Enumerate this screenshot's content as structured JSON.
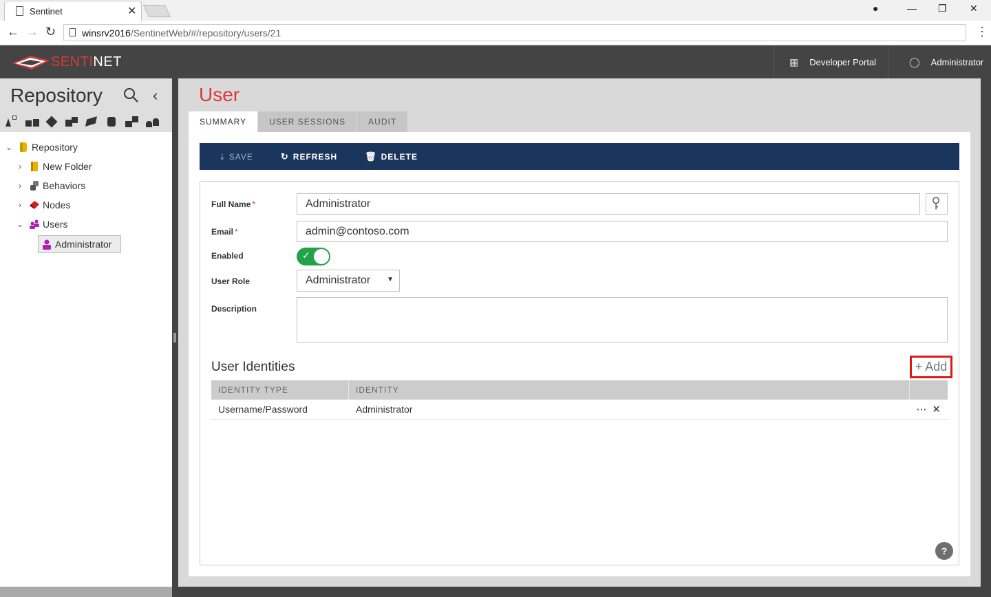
{
  "browser": {
    "tab_title": "Sentinet",
    "url_host": "winsrv2016",
    "url_path": "/SentinetWeb/#/repository/users/21"
  },
  "header": {
    "logo_left": "SENTI",
    "logo_right": "NET",
    "dev_portal_label": "Developer Portal",
    "user_label": "Administrator",
    "accent": "#d93a3a"
  },
  "sidebar": {
    "title": "Repository",
    "filter_icons": [
      "api-filter-icon",
      "lock-filter-icon",
      "service-filter-icon",
      "folder-filter-icon",
      "node-filter-icon",
      "behavior-filter-icon",
      "group-filter-icon",
      "user-filter-icon"
    ],
    "tree": [
      {
        "label": "Repository",
        "icon": "database-icon",
        "expanded": true
      },
      {
        "label": "New Folder",
        "icon": "folder-icon",
        "expanded": false
      },
      {
        "label": "Behaviors",
        "icon": "behaviors-icon",
        "expanded": false
      },
      {
        "label": "Nodes",
        "icon": "nodes-icon",
        "expanded": false
      },
      {
        "label": "Users",
        "icon": "users-icon",
        "expanded": true
      },
      {
        "label": "Administrator",
        "icon": "user-icon",
        "selected": true
      }
    ]
  },
  "main": {
    "title": "User",
    "tabs": [
      {
        "label": "SUMMARY",
        "active": true
      },
      {
        "label": "USER SESSIONS",
        "active": false
      },
      {
        "label": "AUDIT",
        "active": false
      }
    ],
    "toolbar": {
      "save_label": "SAVE",
      "refresh_label": "REFRESH",
      "delete_label": "DELETE",
      "bg_color": "#1b365d"
    },
    "form": {
      "full_name_label": "Full Name",
      "full_name_value": "Administrator",
      "email_label": "Email",
      "email_value": "admin@contoso.com",
      "required_mark": "*",
      "enabled_label": "Enabled",
      "enabled": true,
      "role_label": "User Role",
      "role_value": "Administrator",
      "description_label": "Description",
      "description_value": ""
    },
    "identities": {
      "title": "User Identities",
      "add_label": "+ Add",
      "columns": [
        "IDENTITY TYPE",
        "IDENTITY"
      ],
      "rows": [
        {
          "type": "Username/Password",
          "identity": "Administrator"
        }
      ]
    },
    "help_label": "?"
  }
}
